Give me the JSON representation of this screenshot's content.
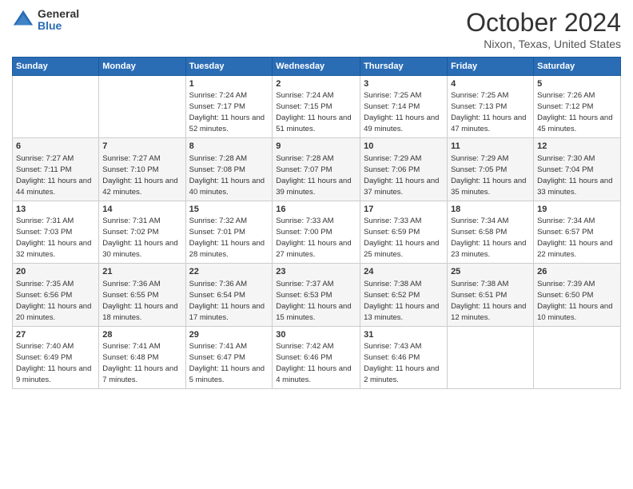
{
  "logo": {
    "general": "General",
    "blue": "Blue"
  },
  "title": "October 2024",
  "subtitle": "Nixon, Texas, United States",
  "days_of_week": [
    "Sunday",
    "Monday",
    "Tuesday",
    "Wednesday",
    "Thursday",
    "Friday",
    "Saturday"
  ],
  "weeks": [
    [
      {
        "day": "",
        "info": ""
      },
      {
        "day": "",
        "info": ""
      },
      {
        "day": "1",
        "info": "Sunrise: 7:24 AM\nSunset: 7:17 PM\nDaylight: 11 hours and 52 minutes."
      },
      {
        "day": "2",
        "info": "Sunrise: 7:24 AM\nSunset: 7:15 PM\nDaylight: 11 hours and 51 minutes."
      },
      {
        "day": "3",
        "info": "Sunrise: 7:25 AM\nSunset: 7:14 PM\nDaylight: 11 hours and 49 minutes."
      },
      {
        "day": "4",
        "info": "Sunrise: 7:25 AM\nSunset: 7:13 PM\nDaylight: 11 hours and 47 minutes."
      },
      {
        "day": "5",
        "info": "Sunrise: 7:26 AM\nSunset: 7:12 PM\nDaylight: 11 hours and 45 minutes."
      }
    ],
    [
      {
        "day": "6",
        "info": "Sunrise: 7:27 AM\nSunset: 7:11 PM\nDaylight: 11 hours and 44 minutes."
      },
      {
        "day": "7",
        "info": "Sunrise: 7:27 AM\nSunset: 7:10 PM\nDaylight: 11 hours and 42 minutes."
      },
      {
        "day": "8",
        "info": "Sunrise: 7:28 AM\nSunset: 7:08 PM\nDaylight: 11 hours and 40 minutes."
      },
      {
        "day": "9",
        "info": "Sunrise: 7:28 AM\nSunset: 7:07 PM\nDaylight: 11 hours and 39 minutes."
      },
      {
        "day": "10",
        "info": "Sunrise: 7:29 AM\nSunset: 7:06 PM\nDaylight: 11 hours and 37 minutes."
      },
      {
        "day": "11",
        "info": "Sunrise: 7:29 AM\nSunset: 7:05 PM\nDaylight: 11 hours and 35 minutes."
      },
      {
        "day": "12",
        "info": "Sunrise: 7:30 AM\nSunset: 7:04 PM\nDaylight: 11 hours and 33 minutes."
      }
    ],
    [
      {
        "day": "13",
        "info": "Sunrise: 7:31 AM\nSunset: 7:03 PM\nDaylight: 11 hours and 32 minutes."
      },
      {
        "day": "14",
        "info": "Sunrise: 7:31 AM\nSunset: 7:02 PM\nDaylight: 11 hours and 30 minutes."
      },
      {
        "day": "15",
        "info": "Sunrise: 7:32 AM\nSunset: 7:01 PM\nDaylight: 11 hours and 28 minutes."
      },
      {
        "day": "16",
        "info": "Sunrise: 7:33 AM\nSunset: 7:00 PM\nDaylight: 11 hours and 27 minutes."
      },
      {
        "day": "17",
        "info": "Sunrise: 7:33 AM\nSunset: 6:59 PM\nDaylight: 11 hours and 25 minutes."
      },
      {
        "day": "18",
        "info": "Sunrise: 7:34 AM\nSunset: 6:58 PM\nDaylight: 11 hours and 23 minutes."
      },
      {
        "day": "19",
        "info": "Sunrise: 7:34 AM\nSunset: 6:57 PM\nDaylight: 11 hours and 22 minutes."
      }
    ],
    [
      {
        "day": "20",
        "info": "Sunrise: 7:35 AM\nSunset: 6:56 PM\nDaylight: 11 hours and 20 minutes."
      },
      {
        "day": "21",
        "info": "Sunrise: 7:36 AM\nSunset: 6:55 PM\nDaylight: 11 hours and 18 minutes."
      },
      {
        "day": "22",
        "info": "Sunrise: 7:36 AM\nSunset: 6:54 PM\nDaylight: 11 hours and 17 minutes."
      },
      {
        "day": "23",
        "info": "Sunrise: 7:37 AM\nSunset: 6:53 PM\nDaylight: 11 hours and 15 minutes."
      },
      {
        "day": "24",
        "info": "Sunrise: 7:38 AM\nSunset: 6:52 PM\nDaylight: 11 hours and 13 minutes."
      },
      {
        "day": "25",
        "info": "Sunrise: 7:38 AM\nSunset: 6:51 PM\nDaylight: 11 hours and 12 minutes."
      },
      {
        "day": "26",
        "info": "Sunrise: 7:39 AM\nSunset: 6:50 PM\nDaylight: 11 hours and 10 minutes."
      }
    ],
    [
      {
        "day": "27",
        "info": "Sunrise: 7:40 AM\nSunset: 6:49 PM\nDaylight: 11 hours and 9 minutes."
      },
      {
        "day": "28",
        "info": "Sunrise: 7:41 AM\nSunset: 6:48 PM\nDaylight: 11 hours and 7 minutes."
      },
      {
        "day": "29",
        "info": "Sunrise: 7:41 AM\nSunset: 6:47 PM\nDaylight: 11 hours and 5 minutes."
      },
      {
        "day": "30",
        "info": "Sunrise: 7:42 AM\nSunset: 6:46 PM\nDaylight: 11 hours and 4 minutes."
      },
      {
        "day": "31",
        "info": "Sunrise: 7:43 AM\nSunset: 6:46 PM\nDaylight: 11 hours and 2 minutes."
      },
      {
        "day": "",
        "info": ""
      },
      {
        "day": "",
        "info": ""
      }
    ]
  ]
}
